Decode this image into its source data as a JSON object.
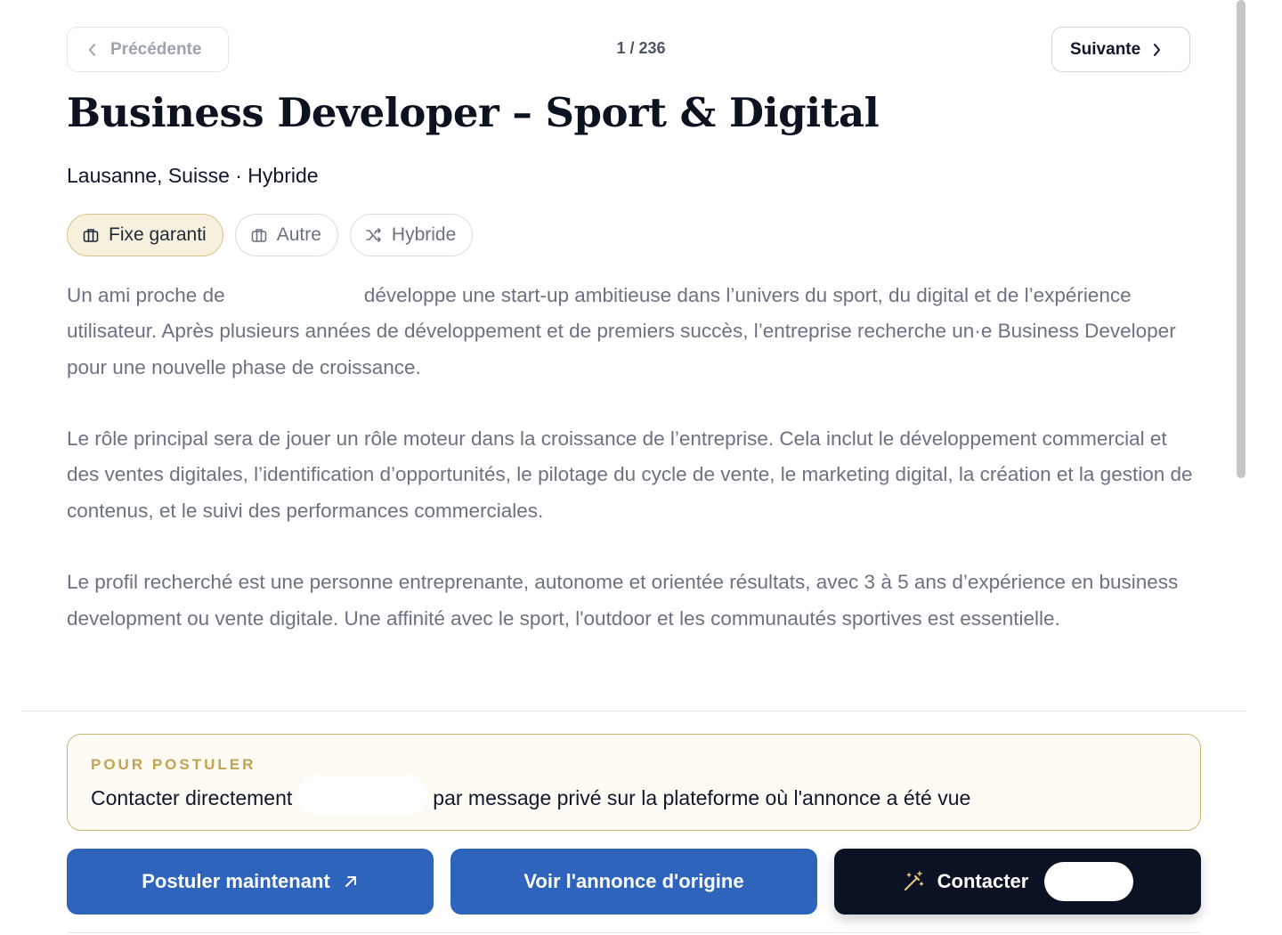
{
  "pagination": {
    "prev_label": "Précédente",
    "next_label": "Suivante",
    "position": "1 / 236"
  },
  "job": {
    "title": "Business Developer – Sport & Digital",
    "location_line": "Lausanne, Suisse · Hybride",
    "tags": [
      {
        "label": "Fixe garanti",
        "icon": "briefcase-icon",
        "active": true
      },
      {
        "label": "Autre",
        "icon": "briefcase-icon",
        "active": false
      },
      {
        "label": "Hybride",
        "icon": "shuffle-icon",
        "active": false
      }
    ],
    "description": {
      "p1_start": "Un ami proche de",
      "p1_end": "développe une start-up ambitieuse dans l’univers du sport, du digital et de l’expérience utilisateur. Après plusieurs années de développement et de premiers succès, l’entreprise recherche un·e Business Developer pour une nouvelle phase de croissance.",
      "p2": "Le rôle principal sera de jouer un rôle moteur dans la croissance de l’entreprise. Cela inclut le développement commercial et des ventes digitales, l’identification d’opportunités, le pilotage du cycle de vente, le marketing digital, la création et la gestion de contenus, et le suivi des performances commerciales.",
      "p3": "Le profil recherché est une personne entreprenante, autonome et orientée résultats, avec 3 à 5 ans d’expérience en business development ou vente digitale. Une affinité avec le sport, l'outdoor et les communautés sportives est essentielle."
    }
  },
  "apply": {
    "label": "POUR POSTULER",
    "text_start": "Contacter directement",
    "text_end": "par message privé sur la plateforme où l'annonce a été vue"
  },
  "actions": {
    "apply_now": "Postuler maintenant",
    "view_original": "Voir l'annonce d'origine",
    "contact": "Contacter"
  },
  "colors": {
    "primary_blue": "#2f64bd",
    "dark": "#0b1224",
    "gold": "#c2a34f",
    "chip_active_bg": "#f7f0dd"
  }
}
